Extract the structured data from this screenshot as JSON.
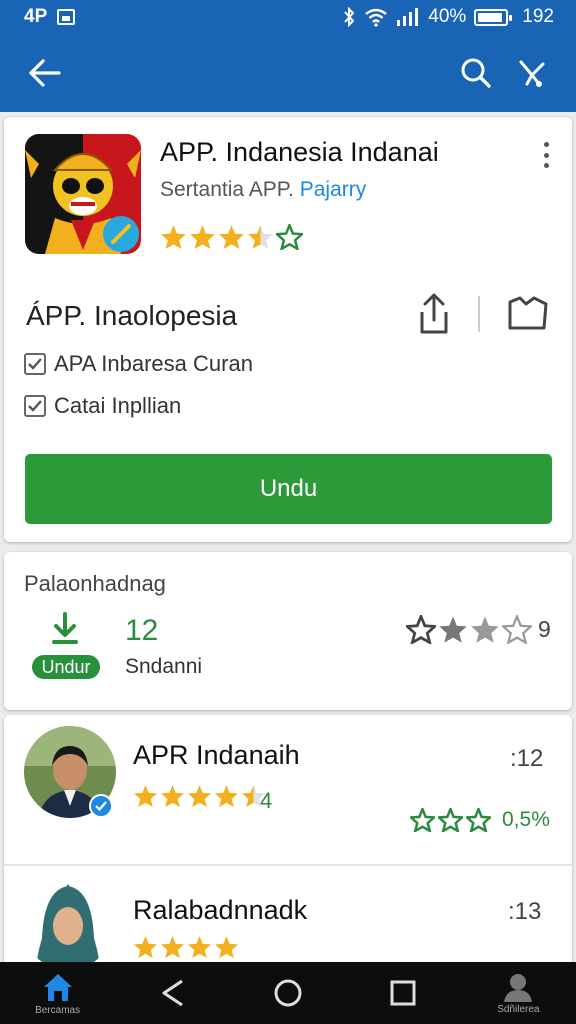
{
  "status_bar": {
    "left_text": "4P",
    "battery": "40%",
    "time": "192"
  },
  "app": {
    "title": "APP. Indanesia Indanai",
    "developer": "Sertantia APP.",
    "developer_tag": "Pajarry",
    "rating_stars": 3.5
  },
  "section": {
    "title": "ÁPP. Inaolopesia",
    "checks": [
      "APA Inbaresa Curan",
      "Catai Inpllian"
    ],
    "install_label": "Undu"
  },
  "downloads": {
    "title": "Palaonhadnag",
    "count": "12",
    "badge": "Undur",
    "subtitle": "Sndanni",
    "rating_count": "9"
  },
  "reviews": [
    {
      "name": "APR Indanaih",
      "stars": 4.5,
      "rating_text": "4",
      "count": ":12",
      "green_rating": "0,5%"
    },
    {
      "name": "Ralabadnnadk",
      "stars": 4,
      "count": ":13"
    }
  ],
  "nav": {
    "home_label": "Bercamas",
    "profile_label": "Sdñilerea"
  },
  "colors": {
    "primary": "#1a64b5",
    "install": "#2b9b3a",
    "star": "#f2b01e",
    "green_text": "#2b8a3e"
  }
}
